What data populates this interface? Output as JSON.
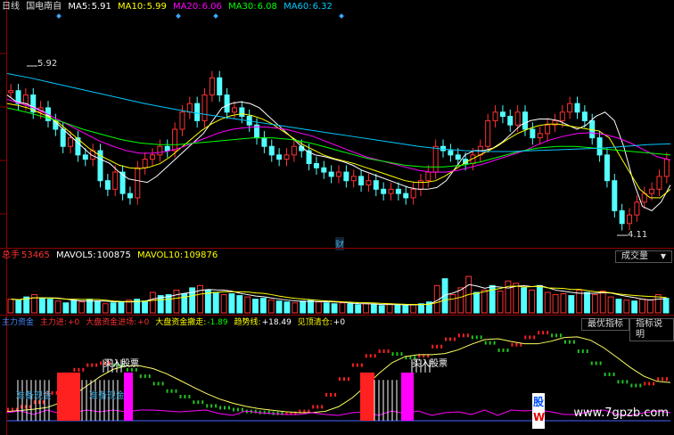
{
  "price_header": {
    "period": "日线",
    "name": "国电南自",
    "ma5_label": "MA5:",
    "ma5": "5.91",
    "ma10_label": "MA10:",
    "ma10": "5.99",
    "ma20_label": "MA20:",
    "ma20": "6.06",
    "ma30_label": "MA30:",
    "ma30": "6.08",
    "ma60_label": "MA60:",
    "ma60": "6.32"
  },
  "price_labels": {
    "high": "5.92",
    "low": "4.11",
    "finance_marker": "财"
  },
  "volume_header": {
    "label": "总手",
    "value": "53465",
    "mavol5_label": "MAVOL5:",
    "mavol5": "100875",
    "mavol10_label": "MAVOL10:",
    "mavol10": "109876"
  },
  "volume_selector": {
    "selected": "成交量",
    "arrow": "▼"
  },
  "indicator_header": {
    "name": "主力资金",
    "main_in_label": "主力进:",
    "main_in": "+0",
    "big_in_label": "大盘资金进场:",
    "big_in": "+0",
    "big_out_label": "大盘资金撤走:",
    "big_out": "-1.89",
    "trend_label": "趋势线:",
    "trend": "+18.49",
    "warn_label": "见顶清仓:",
    "warn": "+0"
  },
  "indicator_buttons": {
    "best": "最优指标",
    "help": "指标说明"
  },
  "indicator_labels": {
    "prepare1": "准备现金",
    "buy1": "买入股票",
    "prepare2": "准备现金",
    "buy2": "买入股票"
  },
  "watermark": {
    "text": "www.7gpzb.com",
    "badge_top": "股",
    "badge_bottom": "W"
  },
  "colors": {
    "ma5": "#ffffff",
    "ma10": "#ffff00",
    "ma20": "#ff00ff",
    "ma30": "#00ff00",
    "ma60": "#00c8ff",
    "up": "#ff3232",
    "down": "#54ffff",
    "axis": "#8b0000"
  },
  "chart_data": {
    "type": "line",
    "candles_close": [
      5.75,
      5.6,
      5.7,
      5.5,
      5.55,
      5.4,
      5.3,
      5.1,
      5.2,
      5.0,
      4.95,
      5.05,
      4.7,
      4.6,
      4.8,
      4.55,
      4.5,
      4.85,
      4.95,
      5.0,
      5.1,
      5.05,
      5.3,
      5.5,
      5.6,
      5.4,
      5.7,
      5.9,
      5.7,
      5.5,
      5.55,
      5.45,
      5.35,
      5.2,
      5.1,
      5.0,
      4.95,
      5.0,
      5.1,
      5.05,
      4.9,
      4.85,
      4.8,
      4.75,
      4.8,
      4.7,
      4.75,
      4.65,
      4.7,
      4.6,
      4.55,
      4.6,
      4.55,
      4.5,
      4.6,
      4.7,
      4.8,
      5.1,
      5.05,
      5.0,
      4.95,
      4.9,
      5.0,
      5.1,
      5.4,
      5.5,
      5.45,
      5.35,
      5.5,
      5.3,
      5.2,
      5.25,
      5.35,
      5.4,
      5.5,
      5.6,
      5.5,
      5.4,
      5.2,
      5.0,
      4.7,
      4.35,
      4.2,
      4.3,
      4.45,
      4.55,
      4.6,
      4.75,
      4.95
    ],
    "series": [
      {
        "name": "MA5",
        "values": [
          5.7,
          5.62,
          5.6,
          5.55,
          5.5,
          5.4,
          5.3,
          5.2,
          5.1,
          5.0,
          4.95,
          4.9,
          4.8,
          4.72,
          4.7,
          4.68,
          4.75,
          4.85,
          4.95,
          5.05,
          5.15,
          5.25,
          5.4,
          5.55,
          5.6,
          5.62,
          5.6,
          5.55,
          5.45,
          5.35,
          5.25,
          5.15,
          5.05,
          5.0,
          4.98,
          4.95,
          4.92,
          4.88,
          4.82,
          4.78,
          4.74,
          4.7,
          4.66,
          4.62,
          4.6,
          4.6,
          4.62,
          4.7,
          4.85,
          5.0,
          5.05,
          5.05,
          5.08,
          5.15,
          5.25,
          5.35,
          5.4,
          5.42,
          5.42,
          5.4,
          5.35,
          5.3,
          5.35,
          5.45,
          5.5,
          5.4,
          5.1,
          4.7,
          4.4,
          4.35,
          4.45,
          4.65
        ]
      },
      {
        "name": "MA10",
        "values": [
          5.6,
          5.58,
          5.55,
          5.5,
          5.45,
          5.38,
          5.28,
          5.18,
          5.08,
          5.0,
          4.94,
          4.88,
          4.85,
          4.84,
          4.86,
          4.9,
          4.98,
          5.08,
          5.18,
          5.28,
          5.36,
          5.42,
          5.46,
          5.48,
          5.46,
          5.42,
          5.36,
          5.28,
          5.2,
          5.12,
          5.06,
          5.0,
          4.96,
          4.93,
          4.9,
          4.86,
          4.82,
          4.78,
          4.74,
          4.7,
          4.68,
          4.68,
          4.7,
          4.76,
          4.84,
          4.92,
          4.98,
          5.04,
          5.1,
          5.18,
          5.25,
          5.3,
          5.34,
          5.36,
          5.36,
          5.34,
          5.32,
          5.3,
          5.28,
          5.2,
          5.0,
          4.8,
          4.6,
          4.5,
          4.5,
          4.6
        ]
      },
      {
        "name": "MA20",
        "values": [
          5.65,
          5.6,
          5.55,
          5.48,
          5.4,
          5.32,
          5.24,
          5.16,
          5.1,
          5.05,
          5.02,
          5.02,
          5.04,
          5.08,
          5.14,
          5.2,
          5.26,
          5.3,
          5.32,
          5.33,
          5.32,
          5.3,
          5.26,
          5.22,
          5.16,
          5.1,
          5.04,
          4.98,
          4.94,
          4.9,
          4.86,
          4.82,
          4.8,
          4.8,
          4.82,
          4.86,
          4.9,
          4.95,
          5.0,
          5.05,
          5.12,
          5.18,
          5.22,
          5.25,
          5.26,
          5.24,
          5.2,
          5.14,
          5.06,
          4.98,
          4.94
        ]
      },
      {
        "name": "MA30",
        "values": [
          5.55,
          5.5,
          5.44,
          5.38,
          5.3,
          5.24,
          5.18,
          5.14,
          5.12,
          5.12,
          5.14,
          5.16,
          5.18,
          5.2,
          5.2,
          5.18,
          5.14,
          5.08,
          5.02,
          4.96,
          4.92,
          4.88,
          4.86,
          4.86,
          4.88,
          4.92,
          4.98,
          5.04,
          5.08,
          5.1,
          5.1,
          5.08,
          5.06,
          5.04,
          5.02,
          5.0
        ]
      },
      {
        "name": "MA60",
        "values": [
          5.95,
          5.9,
          5.84,
          5.78,
          5.72,
          5.66,
          5.6,
          5.55,
          5.5,
          5.46,
          5.42,
          5.38,
          5.34,
          5.3,
          5.26,
          5.22,
          5.18,
          5.14,
          5.1,
          5.07,
          5.05,
          5.04,
          5.04,
          5.05,
          5.06,
          5.07,
          5.08,
          5.1,
          5.12,
          5.13
        ]
      }
    ],
    "volume": [
      30,
      28,
      35,
      40,
      32,
      30,
      26,
      22,
      28,
      24,
      30,
      26,
      20,
      22,
      24,
      28,
      30,
      26,
      45,
      38,
      40,
      50,
      42,
      55,
      60,
      50,
      45,
      40,
      42,
      38,
      35,
      30,
      32,
      28,
      26,
      24,
      22,
      26,
      28,
      24,
      22,
      20,
      22,
      20,
      18,
      20,
      18,
      16,
      20,
      18,
      16,
      18,
      20,
      24,
      60,
      75,
      40,
      55,
      80,
      45,
      50,
      60,
      48,
      70,
      65,
      55,
      50,
      60,
      45,
      40,
      42,
      38,
      50,
      45,
      40,
      48,
      35,
      30,
      28,
      26,
      30,
      28,
      40,
      32
    ],
    "indicator": [
      10,
      12,
      15,
      20,
      30,
      45,
      55,
      60,
      62,
      60,
      55,
      48,
      40,
      32,
      26,
      20,
      16,
      14,
      12,
      10,
      9,
      8,
      8,
      10,
      15,
      28,
      45,
      60,
      70,
      75,
      72,
      68,
      70,
      80,
      88,
      92,
      90,
      84,
      76,
      82,
      90,
      95,
      92,
      85,
      75,
      62,
      50,
      42,
      38,
      40,
      45
    ]
  }
}
